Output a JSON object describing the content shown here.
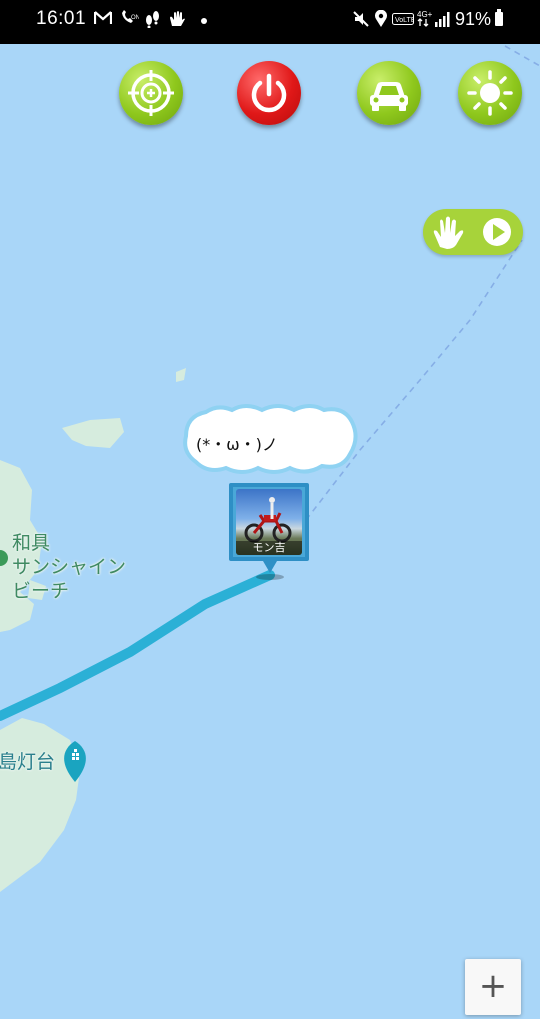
{
  "status_bar": {
    "time": "16:01",
    "battery_percent": "91%",
    "left_icons": [
      "gmail-icon",
      "wifi-call-icon",
      "footprints-icon",
      "hand-notification-icon",
      "dot-icon"
    ],
    "right_icons": [
      "mute-icon",
      "location-icon",
      "volte-icon",
      "4g-icon",
      "signal-icon",
      "battery-icon"
    ]
  },
  "toolbar": {
    "buttons": [
      {
        "name": "target",
        "icon": "crosshair-icon",
        "color": "#8fc81d"
      },
      {
        "name": "power",
        "icon": "power-icon",
        "color": "#e01818"
      },
      {
        "name": "car",
        "icon": "car-icon",
        "color": "#8fc81d"
      },
      {
        "name": "sun",
        "icon": "sun-icon",
        "color": "#8fc81d"
      }
    ]
  },
  "wave_play": {
    "icons": [
      "wave-hand-icon",
      "play-icon"
    ],
    "color": "#a7d33a"
  },
  "speech_bubble": {
    "text": "(*・ω・)ノ"
  },
  "avatar": {
    "name": "モン吉"
  },
  "map": {
    "labels": {
      "beach_line1": "和具",
      "beach_line2": "サンシャイン",
      "beach_line3": "ビーチ",
      "lighthouse": "島灯台"
    },
    "colors": {
      "sea": "#a9d6f8",
      "land": "#d6ecde",
      "route": "#2bb0d6"
    }
  },
  "zoom": {
    "in_label": "+"
  }
}
